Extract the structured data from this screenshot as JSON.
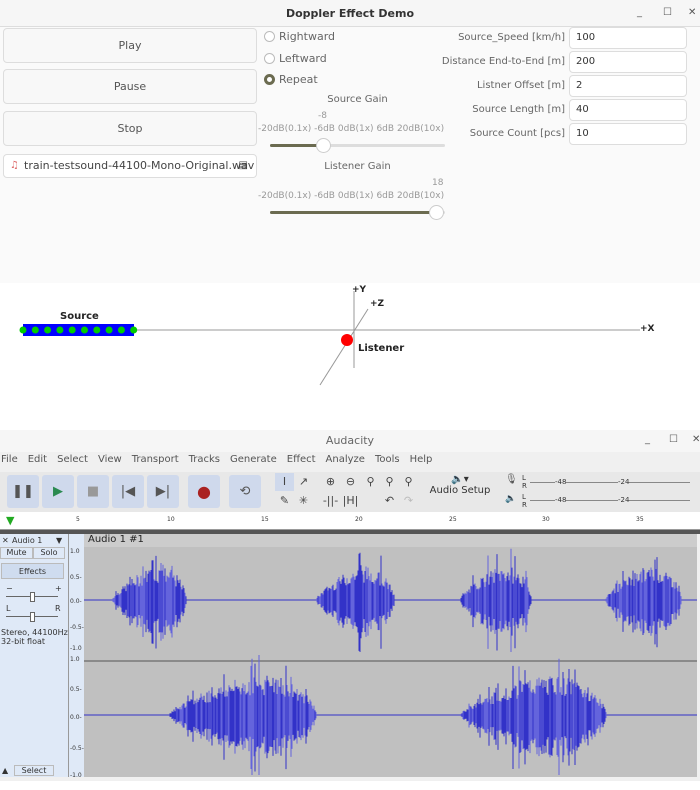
{
  "demo": {
    "title": "Doppler Effect Demo",
    "buttons": {
      "play": "Play",
      "pause": "Pause",
      "stop": "Stop"
    },
    "file": "train-testsound-44100-Mono-Original.wav",
    "radios": [
      {
        "label": "Rightward",
        "checked": false
      },
      {
        "label": "Leftward",
        "checked": false
      },
      {
        "label": "Repeat",
        "checked": true
      }
    ],
    "source_gain": {
      "label": "Source Gain",
      "value": "-8",
      "value_fraction": 0.3,
      "ticks": [
        "-20dB(0.1x)",
        "-6dB",
        "0dB(1x)",
        "6dB",
        "20dB(10x)"
      ]
    },
    "listener_gain": {
      "label": "Listener Gain",
      "value": "18",
      "value_fraction": 0.95,
      "ticks": [
        "-20dB(0.1x)",
        "-6dB",
        "0dB(1x)",
        "6dB",
        "20dB(10x)"
      ]
    },
    "params": [
      {
        "label": "Source_Speed [km/h]",
        "value": "100"
      },
      {
        "label": "Distance End-to-End [m]",
        "value": "200"
      },
      {
        "label": "Listner Offset [m]",
        "value": "2"
      },
      {
        "label": "Source Length [m]",
        "value": "40"
      },
      {
        "label": "Source Count [pcs]",
        "value": "10"
      }
    ],
    "scene": {
      "y": "+Y",
      "z": "+Z",
      "x": "+X",
      "source": "Source",
      "listener": "Listener"
    }
  },
  "audacity": {
    "title": "Audacity",
    "menu": [
      "File",
      "Edit",
      "Select",
      "View",
      "Transport",
      "Tracks",
      "Generate",
      "Effect",
      "Analyze",
      "Tools",
      "Help"
    ],
    "audio_setup": "Audio Setup",
    "meter": [
      "L",
      "R",
      "-48",
      "-24"
    ],
    "ruler": [
      "5",
      "10",
      "15",
      "20",
      "25",
      "30",
      "35"
    ],
    "track": {
      "name": "Audio 1",
      "clip": "Audio 1 #1",
      "mute": "Mute",
      "solo": "Solo",
      "effects": "Effects",
      "info1": "Stereo, 44100Hz",
      "info2": "32-bit float",
      "select": "Select",
      "pan_l": "L",
      "pan_r": "R",
      "gain_minus": "−",
      "gain_plus": "+",
      "scale": [
        "1.0",
        "0.5-",
        "0.0-",
        "-0.5-",
        "-1.0"
      ]
    },
    "colors": {
      "wave": "#3232c8",
      "wave_light": "#6464dc",
      "bg": "#c0c0c0"
    }
  }
}
